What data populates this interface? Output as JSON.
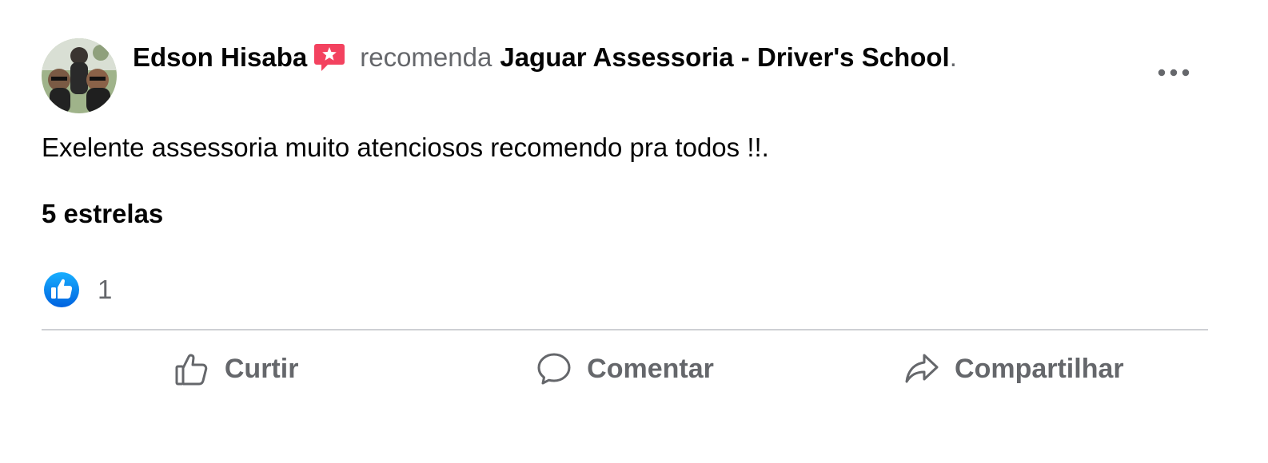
{
  "post": {
    "author": "Edson Hisaba",
    "verb": "recomenda",
    "page_name": "Jaguar Assessoria - Driver's School",
    "page_name_suffix": ".",
    "body": "Exelente assessoria muito atenciosos recomendo pra todos !!.",
    "rating": "5 estrelas",
    "reaction_count": "1"
  },
  "actions": {
    "like_label": "Curtir",
    "comment_label": "Comentar",
    "share_label": "Compartilhar"
  },
  "icons": {
    "recommendation_badge": "star-speech-bubble-icon",
    "more": "more-options-icon",
    "like_reaction": "thumbs-up-reaction-icon",
    "like_action": "thumbs-up-outline-icon",
    "comment_action": "comment-bubble-icon",
    "share_action": "share-arrow-icon"
  },
  "colors": {
    "badge": "#f3425f",
    "like_blue": "#1877f2",
    "secondary_text": "#65676b",
    "divider": "#ced0d4"
  }
}
